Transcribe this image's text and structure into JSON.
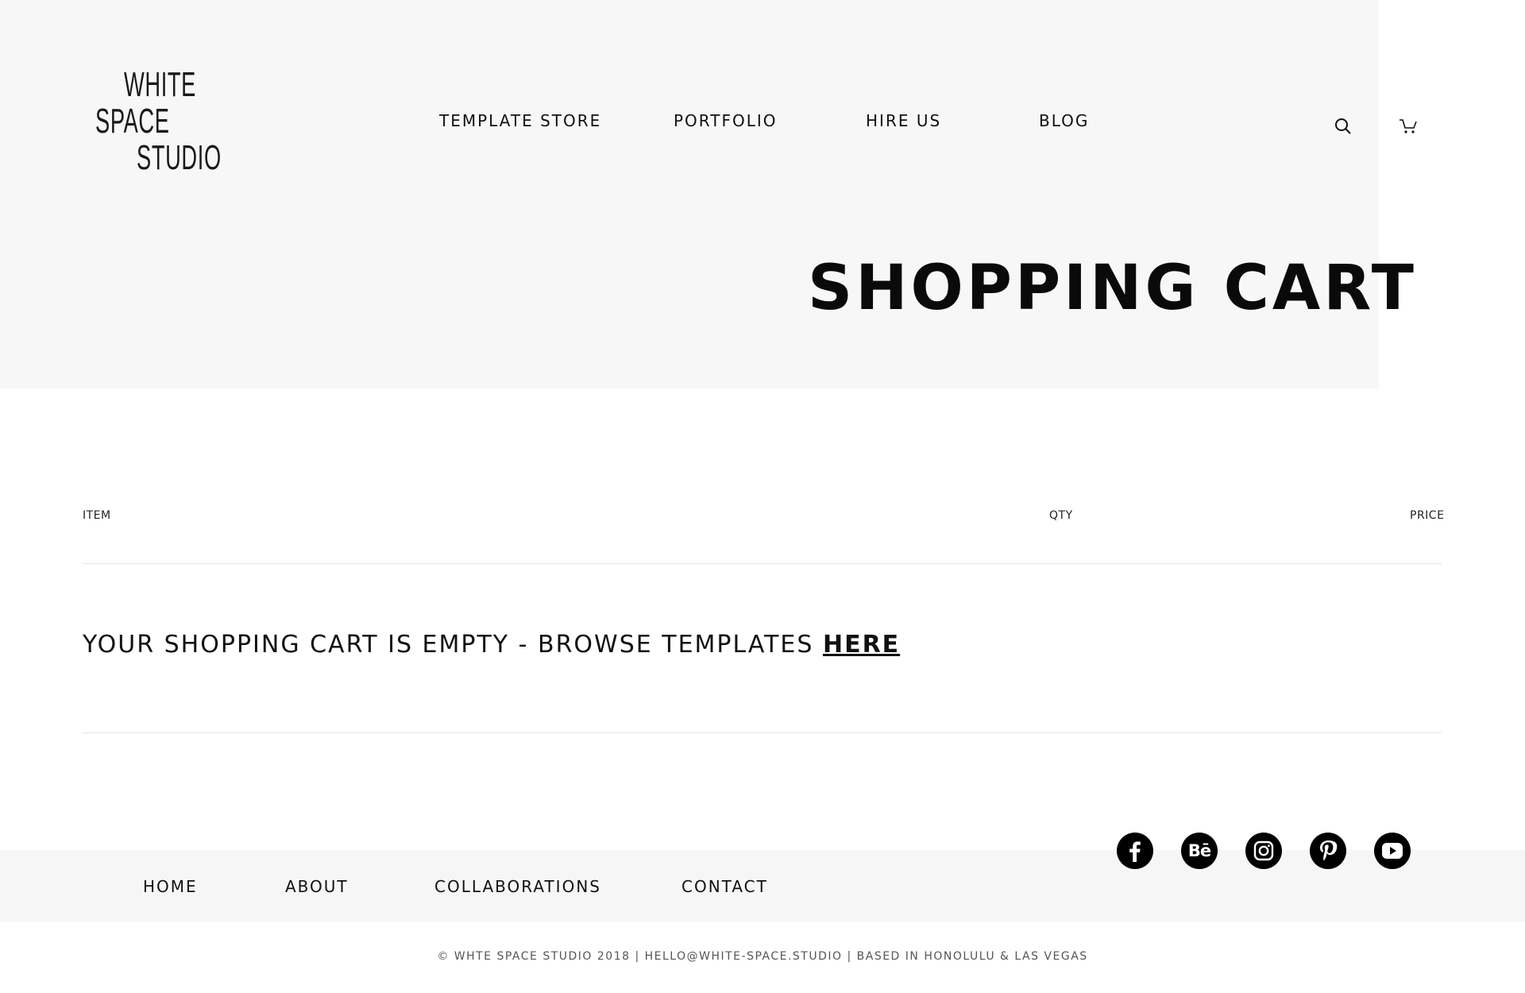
{
  "brand": {
    "logo_lines": [
      "WHITE",
      "SPACE",
      "STUDIO"
    ]
  },
  "nav": {
    "items": [
      {
        "label": "TEMPLATE STORE"
      },
      {
        "label": "PORTFOLIO"
      },
      {
        "label": "HIRE US"
      },
      {
        "label": "BLOG"
      }
    ]
  },
  "header_icons": [
    "search-icon",
    "cart-icon"
  ],
  "page_title": "SHOPPING CART",
  "cart": {
    "columns": {
      "item": "ITEM",
      "qty": "QTY",
      "price": "PRICE"
    },
    "empty_message": "YOUR SHOPPING CART IS EMPTY  - BROWSE TEMPLATES",
    "browse_link": "HERE"
  },
  "footer": {
    "nav": [
      {
        "label": "HOME"
      },
      {
        "label": "ABOUT"
      },
      {
        "label": "COLLABORATIONS"
      },
      {
        "label": "CONTACT"
      }
    ],
    "social": [
      "facebook-icon",
      "behance-icon",
      "instagram-icon",
      "pinterest-icon",
      "youtube-icon"
    ],
    "behance_glyph": "Bē",
    "copyright": "© WHTE SPACE STUDIO 2018 |  HELLO@WHITE-SPACE.STUDIO |   BASED IN HONOLULU & LAS VEGAS"
  },
  "colors": {
    "hero_bg": "#f7f7f7",
    "footer_bg": "#f6f6f6",
    "text": "#111111",
    "rule": "#e6e6e6"
  }
}
